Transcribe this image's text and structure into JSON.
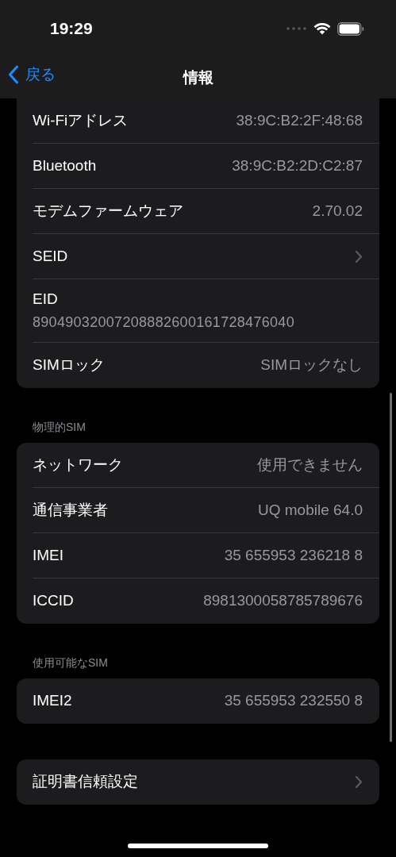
{
  "status_bar": {
    "time": "19:29"
  },
  "nav": {
    "back": "戻る",
    "title": "情報"
  },
  "sections": [
    {
      "rows": [
        {
          "kind": "value",
          "label": "Wi-Fiアドレス",
          "value": "38:9C:B2:2F:48:68"
        },
        {
          "kind": "value",
          "label": "Bluetooth",
          "value": "38:9C:B2:2D:C2:87"
        },
        {
          "kind": "value",
          "label": "モデムファームウェア",
          "value": "2.70.02"
        },
        {
          "kind": "chevron",
          "label": "SEID"
        },
        {
          "kind": "stacked",
          "label": "EID",
          "value": "89049032007208882600161728476040"
        },
        {
          "kind": "value",
          "label": "SIMロック",
          "value": "SIMロックなし"
        }
      ]
    },
    {
      "header": "物理的SIM",
      "rows": [
        {
          "kind": "value",
          "label": "ネットワーク",
          "value": "使用できません"
        },
        {
          "kind": "value",
          "label": "通信事業者",
          "value": "UQ mobile 64.0"
        },
        {
          "kind": "value",
          "label": "IMEI",
          "value": "35 655953 236218 8"
        },
        {
          "kind": "value",
          "label": "ICCID",
          "value": "8981300058785789676"
        }
      ]
    },
    {
      "header": "使用可能なSIM",
      "rows": [
        {
          "kind": "value",
          "label": "IMEI2",
          "value": "35 655953 232550 8"
        }
      ]
    },
    {
      "rows": [
        {
          "kind": "chevron",
          "label": "証明書信頼設定"
        }
      ]
    }
  ]
}
